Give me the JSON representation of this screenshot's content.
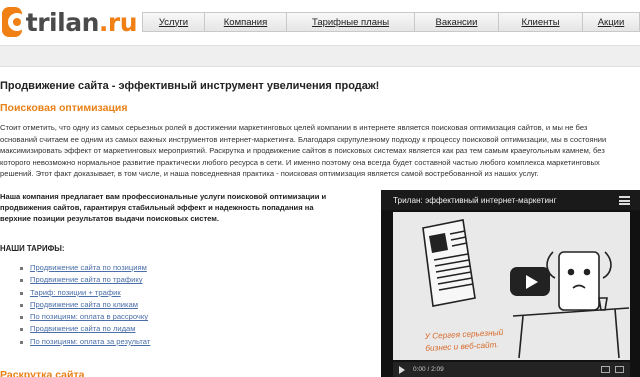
{
  "logo": {
    "name": "trilan",
    "tld": ".ru"
  },
  "nav": [
    {
      "label": "Услуги"
    },
    {
      "label": "Компания"
    },
    {
      "label": "Тарифные планы"
    },
    {
      "label": "Вакансии"
    },
    {
      "label": "Клиенты"
    },
    {
      "label": "Акции"
    }
  ],
  "page": {
    "title": "Продвижение сайта - эффективный инструмент увеличения продаж!",
    "section1_title": "Поисковая оптимизация",
    "intro_lines": [
      "Стоит отметить, что одну из самых серьезных ролей в достижении маркетинговых целей компании в интернете является поисковая оптимизация сайтов, и мы не без",
      "оснований считаем ее одним из самых важных инструментов интернет-маркетинга. Благодаря скрупулезному подходу к процессу поисковой оптимизации, мы в состоянии",
      "максимизировать эффект от маркетинговых мероприятий. Раскрутка и продвижение сайтов в поисковых системах является как раз тем самым краеугольным камнем, без",
      "которого невозможно нормальное развитие практически любого ресурса в сети. И именно поэтому она всегда будет составной частью любого комплекса маркетинговых",
      "решений. Этот факт доказывает, в том числе, и наша повседневная практика - поисковая оптимизация является самой востребованной из наших услуг."
    ],
    "offer_lines": [
      "Наша компания предлагает вам профессиональные услуги поисковой оптимизации и",
      "продвижения сайтов, гарантируя стабильный эффект и надежность попадания на",
      "верхние позиции результатов выдачи поисковых систем."
    ],
    "tariffs_heading": "НАШИ ТАРИФЫ:",
    "tariffs": [
      {
        "label": "Продвижение сайта по позициям"
      },
      {
        "label": "Продвижение сайта по трафику"
      },
      {
        "label": "Тариф: позиции + трафик"
      },
      {
        "label": "Продвижение сайта по кликам"
      },
      {
        "label": "По позициям: оплата в рассрочку"
      },
      {
        "label": "Продвижение сайта по лидам"
      },
      {
        "label": "По позициям: оплата за результат"
      }
    ],
    "section2_title": "Раскрутка сайта"
  },
  "video": {
    "title": "Трилан: эффективный интернет-маркетинг",
    "caption_line1": "У Сергея серьезный",
    "caption_line2": "бизнес и веб-сайт.",
    "time": "0:00 / 2:09"
  }
}
